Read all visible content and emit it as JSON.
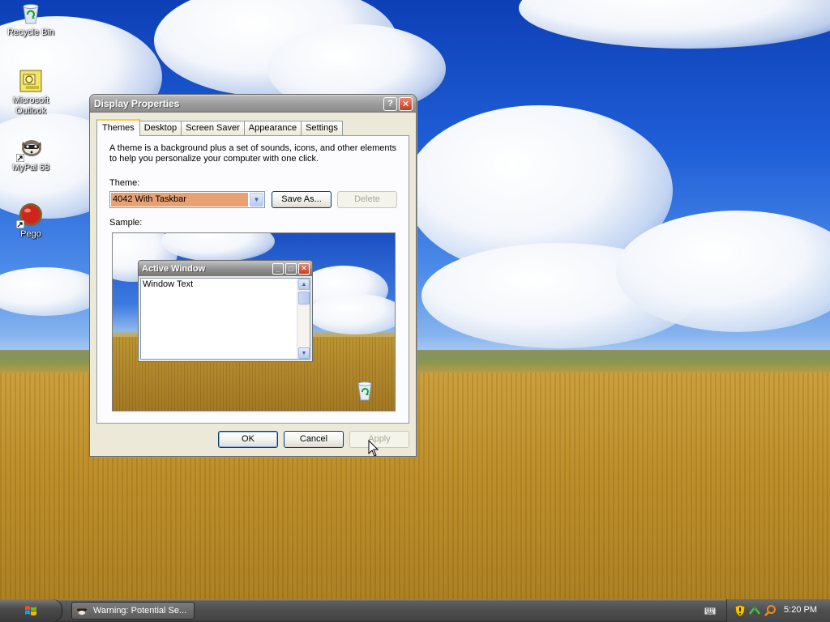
{
  "desktop": {
    "icons": [
      {
        "label": "Recycle Bin",
        "icon": "recycle-bin-icon"
      },
      {
        "label": "Microsoft Outlook",
        "icon": "outlook-icon"
      },
      {
        "label": "MyPal 68",
        "icon": "mypal-raccoon-icon"
      },
      {
        "label": "Pego",
        "icon": "pego-ball-icon"
      }
    ]
  },
  "dialog": {
    "title": "Display Properties",
    "help_glyph": "?",
    "close_glyph": "✕",
    "tabs": [
      "Themes",
      "Desktop",
      "Screen Saver",
      "Appearance",
      "Settings"
    ],
    "active_tab": "Themes",
    "description": "A theme is a background plus a set of sounds, icons, and other elements to help you personalize your computer with one click.",
    "theme_label": "Theme:",
    "theme_value": "4042 With Taskbar",
    "save_as_label": "Save As...",
    "delete_label": "Delete",
    "sample_label": "Sample:",
    "sample": {
      "window_title": "Active Window",
      "window_text": "Window Text",
      "min_glyph": "_",
      "max_glyph": "□",
      "close_glyph": "✕"
    },
    "ok_label": "OK",
    "cancel_label": "Cancel",
    "apply_label": "Apply"
  },
  "taskbar": {
    "task_button_label": "Warning: Potential Se...",
    "clock": "5:20 PM"
  },
  "colors": {
    "selected_theme_bg": "#e8a172",
    "title_bar": "#8c8c8c",
    "close_button": "#c8391b",
    "active_tab_accent": "#ffc83c"
  }
}
